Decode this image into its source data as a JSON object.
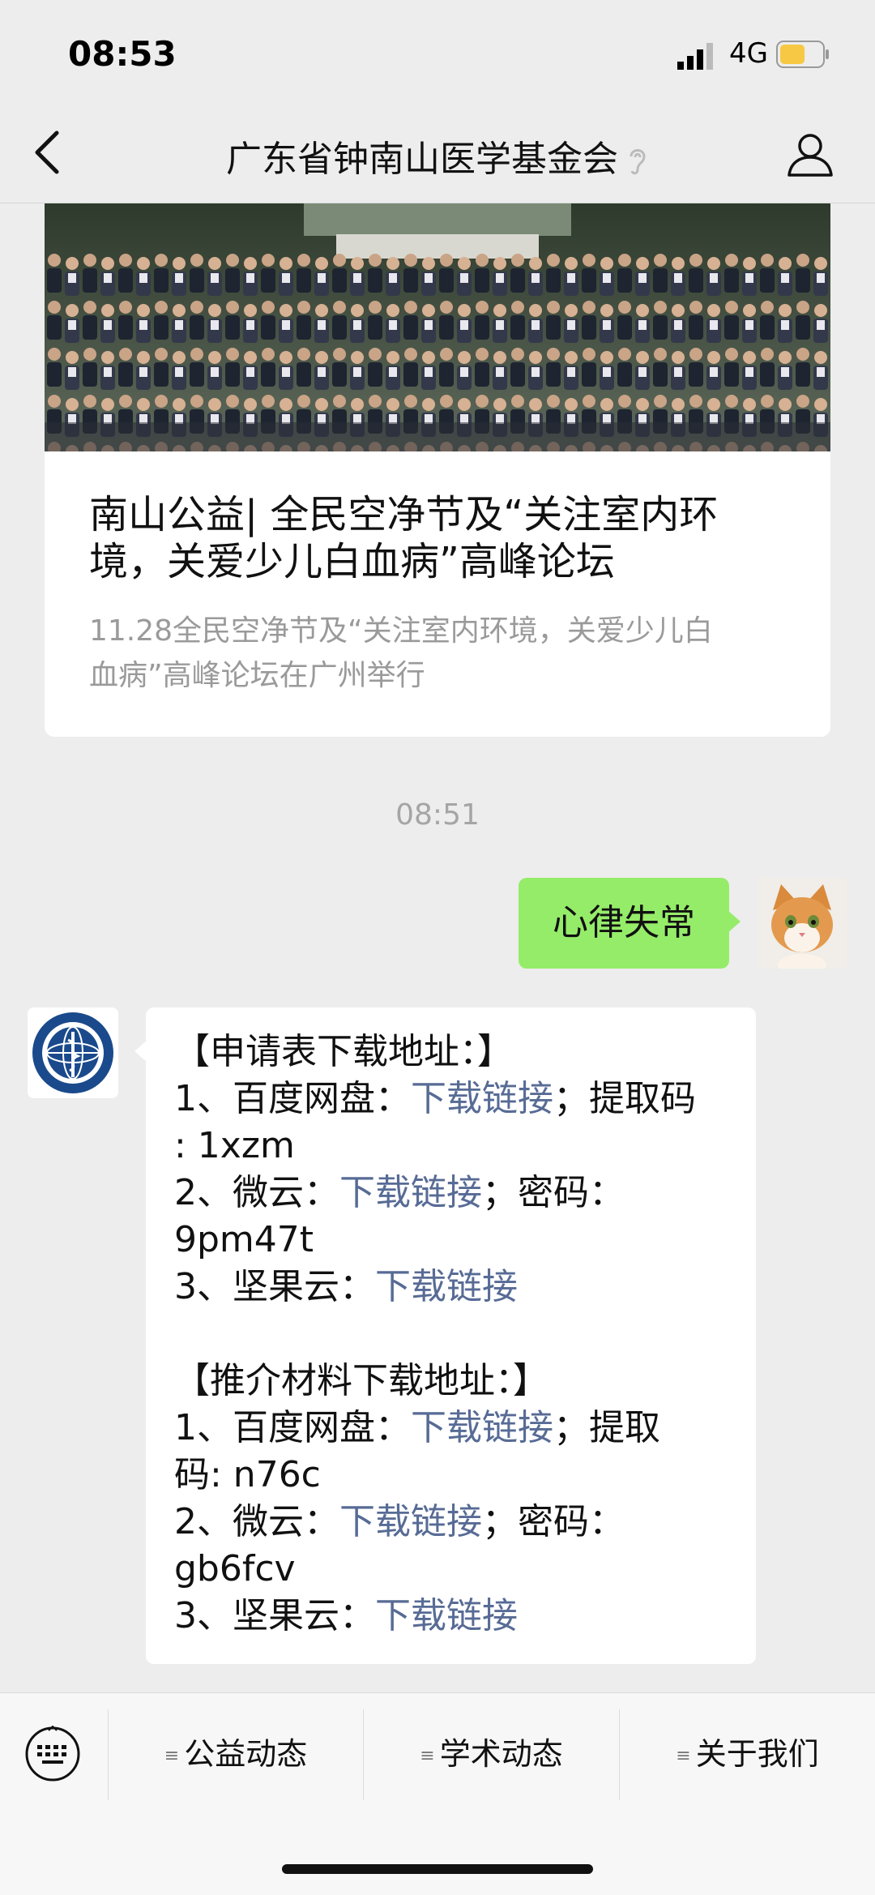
{
  "status_bar": {
    "time": "08:53",
    "network": "4G",
    "battery_color": "#f7c844"
  },
  "nav": {
    "title": "广东省钟南山医学基金会"
  },
  "article": {
    "title_line1": "南山公益| 全民空净节及“关注室内环",
    "title_line2": "境，关爱少儿白血病”高峰论坛",
    "desc_line1": "11.28全民空净节及“关注室内环境，关爱少儿白",
    "desc_line2": "血病”高峰论坛在广州举行"
  },
  "timestamp": "08:51",
  "my_message": {
    "text": "心律失常",
    "bubble_color": "#95ec69"
  },
  "bot_message": {
    "apply_header": "【申请表下载地址：】",
    "apply_1_prefix": "1、百度网盘：",
    "apply_1_link": "下载链接",
    "apply_1_suffix": "；提取码",
    "apply_1_code": ": 1xzm",
    "apply_2_prefix": "2、微云：",
    "apply_2_link": "下载链接",
    "apply_2_suffix": "；密码：",
    "apply_2_code": "9pm47t",
    "apply_3_prefix": "3、坚果云：",
    "apply_3_link": "下载链接",
    "rec_header": "【推介材料下载地址：】",
    "rec_1_prefix": "1、百度网盘：",
    "rec_1_link": "下载链接",
    "rec_1_suffix": "；提取",
    "rec_1_code": "码: n76c",
    "rec_2_prefix": "2、微云：",
    "rec_2_link": "下载链接",
    "rec_2_suffix": "；密码：",
    "rec_2_code": "gb6fcv",
    "rec_3_prefix": "3、坚果云：",
    "rec_3_link": "下载链接",
    "link_color": "#576b95"
  },
  "bottom_menu": {
    "items": [
      {
        "label": "公益动态"
      },
      {
        "label": "学术动态"
      },
      {
        "label": "关于我们"
      }
    ]
  }
}
